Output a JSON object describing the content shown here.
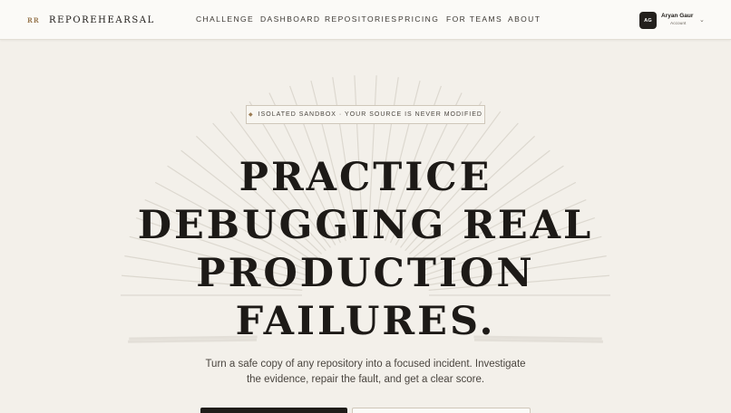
{
  "brand": {
    "mark": "RR",
    "name": "REPOREHEARSAL"
  },
  "nav": [
    {
      "label": "CHALLENGE"
    },
    {
      "label": "DASHBOARD"
    },
    {
      "label": "REPOSITORIES"
    },
    {
      "label": "PRICING"
    },
    {
      "label": "FOR TEAMS"
    },
    {
      "label": "ABOUT"
    }
  ],
  "account": {
    "initials": "AG",
    "name": "Aryan Gaur",
    "subtitle": "Account"
  },
  "hero": {
    "badge": "ISOLATED SANDBOX · YOUR SOURCE IS NEVER MODIFIED",
    "title_lines": [
      "PRACTICE",
      "DEBUGGING REAL",
      "PRODUCTION",
      "FAILURES."
    ],
    "subtitle_lines": [
      "Turn a safe copy of any repository into a focused incident. Investigate",
      "the evidence, repair the fault, and get a clear score."
    ]
  },
  "colors": {
    "accent": "#9a7a52",
    "background": "#f3f0ea",
    "ink": "#1d1a17"
  }
}
